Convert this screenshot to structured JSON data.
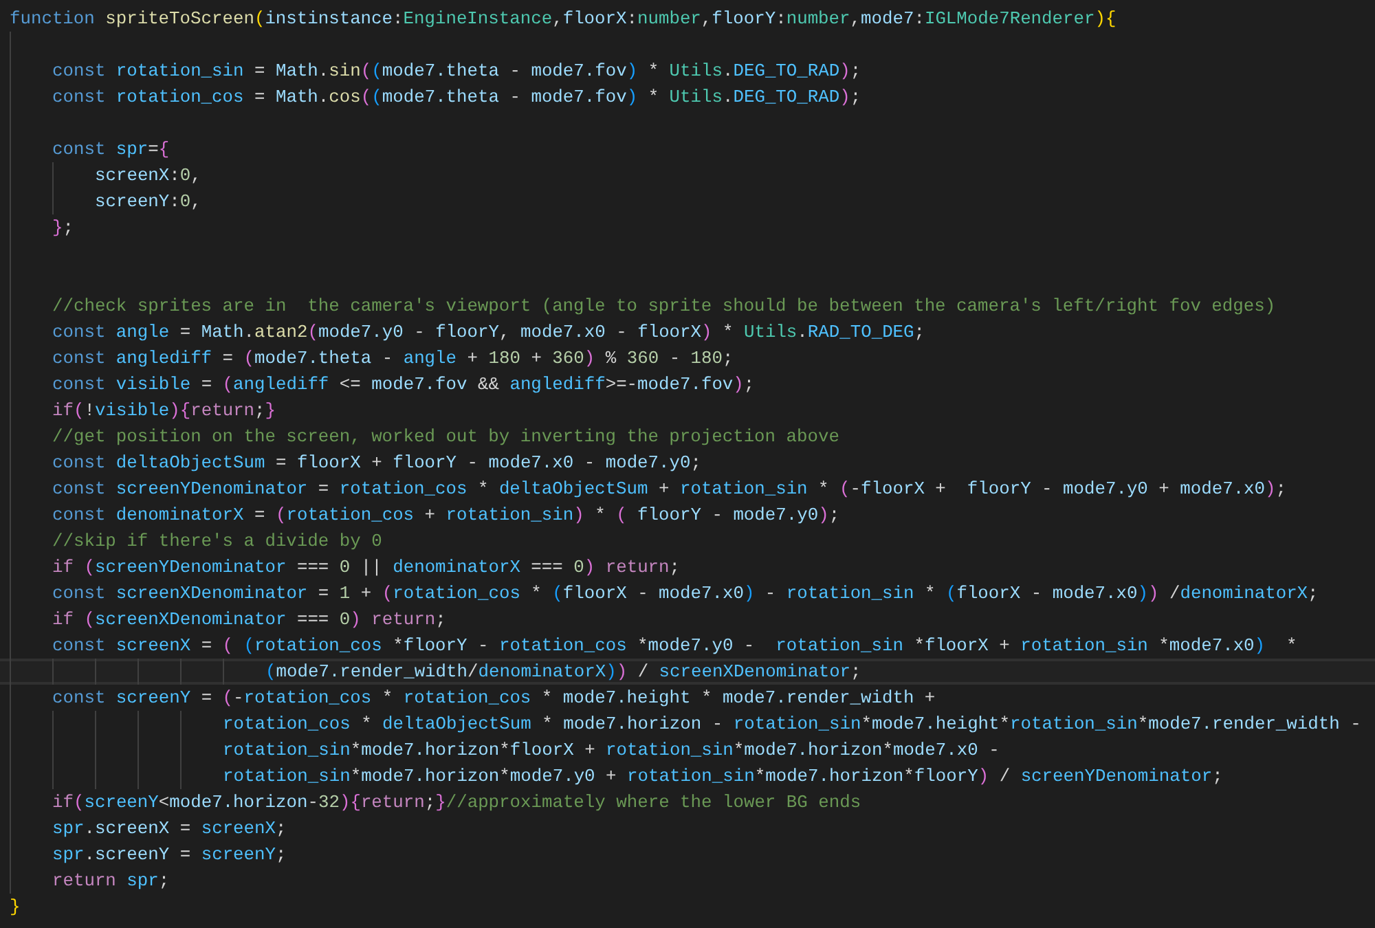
{
  "editor": {
    "lines": [
      {
        "current": false,
        "code": [
          {
            "kind": "kw",
            "text": "function "
          },
          {
            "kind": "fn",
            "text": "spriteToScreen"
          },
          {
            "kind": "b1",
            "text": "("
          },
          {
            "kind": "var",
            "text": "instinstance"
          },
          {
            "kind": "op",
            "text": ":"
          },
          {
            "kind": "type",
            "text": "EngineInstance"
          },
          {
            "kind": "op",
            "text": ","
          },
          {
            "kind": "var",
            "text": "floorX"
          },
          {
            "kind": "op",
            "text": ":"
          },
          {
            "kind": "type",
            "text": "number"
          },
          {
            "kind": "op",
            "text": ","
          },
          {
            "kind": "var",
            "text": "floorY"
          },
          {
            "kind": "op",
            "text": ":"
          },
          {
            "kind": "type",
            "text": "number"
          },
          {
            "kind": "op",
            "text": ","
          },
          {
            "kind": "var",
            "text": "mode7"
          },
          {
            "kind": "op",
            "text": ":"
          },
          {
            "kind": "type",
            "text": "IGLMode7Renderer"
          },
          {
            "kind": "b1",
            "text": "){"
          }
        ]
      },
      {
        "current": false
      },
      {
        "current": false,
        "code": [
          {
            "kind": "kw",
            "text": "    const "
          },
          {
            "kind": "cst",
            "text": "rotation_sin"
          },
          {
            "kind": "op",
            "text": " = "
          },
          {
            "kind": "var",
            "text": "Math"
          },
          {
            "kind": "op",
            "text": "."
          },
          {
            "kind": "fn",
            "text": "sin"
          },
          {
            "kind": "b2",
            "text": "("
          },
          {
            "kind": "b3",
            "text": "("
          },
          {
            "kind": "var",
            "text": "mode7.theta"
          },
          {
            "kind": "op",
            "text": " - "
          },
          {
            "kind": "var",
            "text": "mode7.fov"
          },
          {
            "kind": "b3",
            "text": ")"
          },
          {
            "kind": "op",
            "text": " * "
          },
          {
            "kind": "type",
            "text": "Utils"
          },
          {
            "kind": "op",
            "text": "."
          },
          {
            "kind": "cst",
            "text": "DEG_TO_RAD"
          },
          {
            "kind": "b2",
            "text": ")"
          },
          {
            "kind": "op",
            "text": ";"
          }
        ]
      },
      {
        "current": false,
        "code": [
          {
            "kind": "kw",
            "text": "    const "
          },
          {
            "kind": "cst",
            "text": "rotation_cos"
          },
          {
            "kind": "op",
            "text": " = "
          },
          {
            "kind": "var",
            "text": "Math"
          },
          {
            "kind": "op",
            "text": "."
          },
          {
            "kind": "fn",
            "text": "cos"
          },
          {
            "kind": "b2",
            "text": "("
          },
          {
            "kind": "b3",
            "text": "("
          },
          {
            "kind": "var",
            "text": "mode7.theta"
          },
          {
            "kind": "op",
            "text": " - "
          },
          {
            "kind": "var",
            "text": "mode7.fov"
          },
          {
            "kind": "b3",
            "text": ")"
          },
          {
            "kind": "op",
            "text": " * "
          },
          {
            "kind": "type",
            "text": "Utils"
          },
          {
            "kind": "op",
            "text": "."
          },
          {
            "kind": "cst",
            "text": "DEG_TO_RAD"
          },
          {
            "kind": "b2",
            "text": ")"
          },
          {
            "kind": "op",
            "text": ";"
          }
        ]
      },
      {
        "current": false
      },
      {
        "current": false,
        "code": [
          {
            "kind": "kw",
            "text": "    const "
          },
          {
            "kind": "cst",
            "text": "spr"
          },
          {
            "kind": "op",
            "text": "="
          },
          {
            "kind": "b2",
            "text": "{"
          }
        ]
      },
      {
        "current": false,
        "code": [
          {
            "kind": "var",
            "text": "        screenX"
          },
          {
            "kind": "op",
            "text": ":"
          },
          {
            "kind": "num",
            "text": "0"
          },
          {
            "kind": "op",
            "text": ","
          }
        ]
      },
      {
        "current": false,
        "code": [
          {
            "kind": "var",
            "text": "        screenY"
          },
          {
            "kind": "op",
            "text": ":"
          },
          {
            "kind": "num",
            "text": "0"
          },
          {
            "kind": "op",
            "text": ","
          }
        ]
      },
      {
        "current": false,
        "code": [
          {
            "kind": "b2",
            "text": "    }"
          },
          {
            "kind": "op",
            "text": ";"
          }
        ]
      },
      {
        "current": false
      },
      {
        "current": false
      },
      {
        "current": false,
        "code": [
          {
            "kind": "cmt",
            "text": "    //check sprites are in  the camera's viewport (angle to sprite should be between the camera's left/right fov edges)"
          }
        ]
      },
      {
        "current": false,
        "code": [
          {
            "kind": "kw",
            "text": "    const "
          },
          {
            "kind": "cst",
            "text": "angle"
          },
          {
            "kind": "op",
            "text": " = "
          },
          {
            "kind": "var",
            "text": "Math"
          },
          {
            "kind": "op",
            "text": "."
          },
          {
            "kind": "fn",
            "text": "atan2"
          },
          {
            "kind": "b2",
            "text": "("
          },
          {
            "kind": "var",
            "text": "mode7.y0"
          },
          {
            "kind": "op",
            "text": " - "
          },
          {
            "kind": "var",
            "text": "floorY"
          },
          {
            "kind": "op",
            "text": ", "
          },
          {
            "kind": "var",
            "text": "mode7.x0"
          },
          {
            "kind": "op",
            "text": " - "
          },
          {
            "kind": "var",
            "text": "floorX"
          },
          {
            "kind": "b2",
            "text": ")"
          },
          {
            "kind": "op",
            "text": " * "
          },
          {
            "kind": "type",
            "text": "Utils"
          },
          {
            "kind": "op",
            "text": "."
          },
          {
            "kind": "cst",
            "text": "RAD_TO_DEG"
          },
          {
            "kind": "op",
            "text": ";"
          }
        ]
      },
      {
        "current": false,
        "code": [
          {
            "kind": "kw",
            "text": "    const "
          },
          {
            "kind": "cst",
            "text": "anglediff"
          },
          {
            "kind": "op",
            "text": " = "
          },
          {
            "kind": "b2",
            "text": "("
          },
          {
            "kind": "var",
            "text": "mode7.theta"
          },
          {
            "kind": "op",
            "text": " - "
          },
          {
            "kind": "cst",
            "text": "angle"
          },
          {
            "kind": "op",
            "text": " + "
          },
          {
            "kind": "num",
            "text": "180"
          },
          {
            "kind": "op",
            "text": " + "
          },
          {
            "kind": "num",
            "text": "360"
          },
          {
            "kind": "b2",
            "text": ")"
          },
          {
            "kind": "op",
            "text": " % "
          },
          {
            "kind": "num",
            "text": "360"
          },
          {
            "kind": "op",
            "text": " - "
          },
          {
            "kind": "num",
            "text": "180"
          },
          {
            "kind": "op",
            "text": ";"
          }
        ]
      },
      {
        "current": false,
        "code": [
          {
            "kind": "kw",
            "text": "    const "
          },
          {
            "kind": "cst",
            "text": "visible"
          },
          {
            "kind": "op",
            "text": " = "
          },
          {
            "kind": "b2",
            "text": "("
          },
          {
            "kind": "cst",
            "text": "anglediff"
          },
          {
            "kind": "op",
            "text": " <= "
          },
          {
            "kind": "var",
            "text": "mode7.fov"
          },
          {
            "kind": "op",
            "text": " && "
          },
          {
            "kind": "cst",
            "text": "anglediff"
          },
          {
            "kind": "op",
            "text": ">=-"
          },
          {
            "kind": "var",
            "text": "mode7.fov"
          },
          {
            "kind": "b2",
            "text": ")"
          },
          {
            "kind": "op",
            "text": ";"
          }
        ]
      },
      {
        "current": false,
        "code": [
          {
            "kind": "ctl",
            "text": "    if"
          },
          {
            "kind": "b2",
            "text": "("
          },
          {
            "kind": "op",
            "text": "!"
          },
          {
            "kind": "cst",
            "text": "visible"
          },
          {
            "kind": "b2",
            "text": "){"
          },
          {
            "kind": "ctl",
            "text": "return"
          },
          {
            "kind": "op",
            "text": ";"
          },
          {
            "kind": "b2",
            "text": "}"
          }
        ]
      },
      {
        "current": false,
        "code": [
          {
            "kind": "cmt",
            "text": "    //get position on the screen, worked out by inverting the projection above"
          }
        ]
      },
      {
        "current": false,
        "code": [
          {
            "kind": "kw",
            "text": "    const "
          },
          {
            "kind": "cst",
            "text": "deltaObjectSum"
          },
          {
            "kind": "op",
            "text": " = "
          },
          {
            "kind": "var",
            "text": "floorX"
          },
          {
            "kind": "op",
            "text": " + "
          },
          {
            "kind": "var",
            "text": "floorY"
          },
          {
            "kind": "op",
            "text": " - "
          },
          {
            "kind": "var",
            "text": "mode7.x0"
          },
          {
            "kind": "op",
            "text": " - "
          },
          {
            "kind": "var",
            "text": "mode7.y0"
          },
          {
            "kind": "op",
            "text": ";"
          }
        ]
      },
      {
        "current": false,
        "code": [
          {
            "kind": "kw",
            "text": "    const "
          },
          {
            "kind": "cst",
            "text": "screenYDenominator"
          },
          {
            "kind": "op",
            "text": " = "
          },
          {
            "kind": "cst",
            "text": "rotation_cos"
          },
          {
            "kind": "op",
            "text": " * "
          },
          {
            "kind": "cst",
            "text": "deltaObjectSum"
          },
          {
            "kind": "op",
            "text": " + "
          },
          {
            "kind": "cst",
            "text": "rotation_sin"
          },
          {
            "kind": "op",
            "text": " * "
          },
          {
            "kind": "b2",
            "text": "("
          },
          {
            "kind": "op",
            "text": "-"
          },
          {
            "kind": "var",
            "text": "floorX"
          },
          {
            "kind": "op",
            "text": " +  "
          },
          {
            "kind": "var",
            "text": "floorY"
          },
          {
            "kind": "op",
            "text": " - "
          },
          {
            "kind": "var",
            "text": "mode7.y0"
          },
          {
            "kind": "op",
            "text": " + "
          },
          {
            "kind": "var",
            "text": "mode7.x0"
          },
          {
            "kind": "b2",
            "text": ")"
          },
          {
            "kind": "op",
            "text": ";"
          }
        ]
      },
      {
        "current": false,
        "code": [
          {
            "kind": "kw",
            "text": "    const "
          },
          {
            "kind": "cst",
            "text": "denominatorX"
          },
          {
            "kind": "op",
            "text": " = "
          },
          {
            "kind": "b2",
            "text": "("
          },
          {
            "kind": "cst",
            "text": "rotation_cos"
          },
          {
            "kind": "op",
            "text": " + "
          },
          {
            "kind": "cst",
            "text": "rotation_sin"
          },
          {
            "kind": "b2",
            "text": ")"
          },
          {
            "kind": "op",
            "text": " * "
          },
          {
            "kind": "b2",
            "text": "( "
          },
          {
            "kind": "var",
            "text": "floorY"
          },
          {
            "kind": "op",
            "text": " - "
          },
          {
            "kind": "var",
            "text": "mode7.y0"
          },
          {
            "kind": "b2",
            "text": ")"
          },
          {
            "kind": "op",
            "text": ";"
          }
        ]
      },
      {
        "current": false,
        "code": [
          {
            "kind": "cmt",
            "text": "    //skip if there's a divide by 0"
          }
        ]
      },
      {
        "current": false,
        "code": [
          {
            "kind": "ctl",
            "text": "    if "
          },
          {
            "kind": "b2",
            "text": "("
          },
          {
            "kind": "cst",
            "text": "screenYDenominator"
          },
          {
            "kind": "op",
            "text": " === "
          },
          {
            "kind": "num",
            "text": "0"
          },
          {
            "kind": "op",
            "text": " || "
          },
          {
            "kind": "cst",
            "text": "denominatorX"
          },
          {
            "kind": "op",
            "text": " === "
          },
          {
            "kind": "num",
            "text": "0"
          },
          {
            "kind": "b2",
            "text": ")"
          },
          {
            "kind": "ctl",
            "text": " return"
          },
          {
            "kind": "op",
            "text": ";"
          }
        ]
      },
      {
        "current": false,
        "code": [
          {
            "kind": "kw",
            "text": "    const "
          },
          {
            "kind": "cst",
            "text": "screenXDenominator"
          },
          {
            "kind": "op",
            "text": " = "
          },
          {
            "kind": "num",
            "text": "1"
          },
          {
            "kind": "op",
            "text": " + "
          },
          {
            "kind": "b2",
            "text": "("
          },
          {
            "kind": "cst",
            "text": "rotation_cos"
          },
          {
            "kind": "op",
            "text": " * "
          },
          {
            "kind": "b3",
            "text": "("
          },
          {
            "kind": "var",
            "text": "floorX"
          },
          {
            "kind": "op",
            "text": " - "
          },
          {
            "kind": "var",
            "text": "mode7.x0"
          },
          {
            "kind": "b3",
            "text": ")"
          },
          {
            "kind": "op",
            "text": " - "
          },
          {
            "kind": "cst",
            "text": "rotation_sin"
          },
          {
            "kind": "op",
            "text": " * "
          },
          {
            "kind": "b3",
            "text": "("
          },
          {
            "kind": "var",
            "text": "floorX"
          },
          {
            "kind": "op",
            "text": " - "
          },
          {
            "kind": "var",
            "text": "mode7.x0"
          },
          {
            "kind": "b3",
            "text": ")"
          },
          {
            "kind": "b2",
            "text": ")"
          },
          {
            "kind": "op",
            "text": " /"
          },
          {
            "kind": "cst",
            "text": "denominatorX"
          },
          {
            "kind": "op",
            "text": ";"
          }
        ]
      },
      {
        "current": false,
        "code": [
          {
            "kind": "ctl",
            "text": "    if "
          },
          {
            "kind": "b2",
            "text": "("
          },
          {
            "kind": "cst",
            "text": "screenXDenominator"
          },
          {
            "kind": "op",
            "text": " === "
          },
          {
            "kind": "num",
            "text": "0"
          },
          {
            "kind": "b2",
            "text": ")"
          },
          {
            "kind": "ctl",
            "text": " return"
          },
          {
            "kind": "op",
            "text": ";"
          }
        ]
      },
      {
        "current": false,
        "code": [
          {
            "kind": "kw",
            "text": "    const "
          },
          {
            "kind": "cst",
            "text": "screenX"
          },
          {
            "kind": "op",
            "text": " = "
          },
          {
            "kind": "b2",
            "text": "( "
          },
          {
            "kind": "b3",
            "text": "("
          },
          {
            "kind": "cst",
            "text": "rotation_cos"
          },
          {
            "kind": "op",
            "text": " *"
          },
          {
            "kind": "var",
            "text": "floorY"
          },
          {
            "kind": "op",
            "text": " - "
          },
          {
            "kind": "cst",
            "text": "rotation_cos"
          },
          {
            "kind": "op",
            "text": " *"
          },
          {
            "kind": "var",
            "text": "mode7.y0"
          },
          {
            "kind": "op",
            "text": " -  "
          },
          {
            "kind": "cst",
            "text": "rotation_sin"
          },
          {
            "kind": "op",
            "text": " *"
          },
          {
            "kind": "var",
            "text": "floorX"
          },
          {
            "kind": "op",
            "text": " + "
          },
          {
            "kind": "cst",
            "text": "rotation_sin"
          },
          {
            "kind": "op",
            "text": " *"
          },
          {
            "kind": "var",
            "text": "mode7.x0"
          },
          {
            "kind": "b3",
            "text": ")"
          },
          {
            "kind": "op",
            "text": "  *"
          }
        ]
      },
      {
        "current": true,
        "code": [
          {
            "kind": "b3",
            "text": "                        ("
          },
          {
            "kind": "var",
            "text": "mode7.render_width"
          },
          {
            "kind": "op",
            "text": "/"
          },
          {
            "kind": "cst",
            "text": "denominatorX"
          },
          {
            "kind": "b3",
            "text": ")"
          },
          {
            "kind": "b2",
            "text": ")"
          },
          {
            "kind": "op",
            "text": " / "
          },
          {
            "kind": "cst",
            "text": "screenXDenominator"
          },
          {
            "kind": "op",
            "text": ";"
          }
        ]
      },
      {
        "current": false,
        "code": [
          {
            "kind": "kw",
            "text": "    const "
          },
          {
            "kind": "cst",
            "text": "screenY"
          },
          {
            "kind": "op",
            "text": " = "
          },
          {
            "kind": "b2",
            "text": "("
          },
          {
            "kind": "op",
            "text": "-"
          },
          {
            "kind": "cst",
            "text": "rotation_cos"
          },
          {
            "kind": "op",
            "text": " * "
          },
          {
            "kind": "cst",
            "text": "rotation_cos"
          },
          {
            "kind": "op",
            "text": " * "
          },
          {
            "kind": "var",
            "text": "mode7.height"
          },
          {
            "kind": "op",
            "text": " * "
          },
          {
            "kind": "var",
            "text": "mode7.render_width"
          },
          {
            "kind": "op",
            "text": " +"
          }
        ]
      },
      {
        "current": false,
        "code": [
          {
            "kind": "cst",
            "text": "                    rotation_cos"
          },
          {
            "kind": "op",
            "text": " * "
          },
          {
            "kind": "cst",
            "text": "deltaObjectSum"
          },
          {
            "kind": "op",
            "text": " * "
          },
          {
            "kind": "var",
            "text": "mode7.horizon"
          },
          {
            "kind": "op",
            "text": " - "
          },
          {
            "kind": "cst",
            "text": "rotation_sin"
          },
          {
            "kind": "op",
            "text": "*"
          },
          {
            "kind": "var",
            "text": "mode7.height"
          },
          {
            "kind": "op",
            "text": "*"
          },
          {
            "kind": "cst",
            "text": "rotation_sin"
          },
          {
            "kind": "op",
            "text": "*"
          },
          {
            "kind": "var",
            "text": "mode7.render_width"
          },
          {
            "kind": "op",
            "text": " -"
          }
        ]
      },
      {
        "current": false,
        "code": [
          {
            "kind": "cst",
            "text": "                    rotation_sin"
          },
          {
            "kind": "op",
            "text": "*"
          },
          {
            "kind": "var",
            "text": "mode7.horizon"
          },
          {
            "kind": "op",
            "text": "*"
          },
          {
            "kind": "var",
            "text": "floorX"
          },
          {
            "kind": "op",
            "text": " + "
          },
          {
            "kind": "cst",
            "text": "rotation_sin"
          },
          {
            "kind": "op",
            "text": "*"
          },
          {
            "kind": "var",
            "text": "mode7.horizon"
          },
          {
            "kind": "op",
            "text": "*"
          },
          {
            "kind": "var",
            "text": "mode7.x0"
          },
          {
            "kind": "op",
            "text": " -"
          }
        ]
      },
      {
        "current": false,
        "code": [
          {
            "kind": "cst",
            "text": "                    rotation_sin"
          },
          {
            "kind": "op",
            "text": "*"
          },
          {
            "kind": "var",
            "text": "mode7.horizon"
          },
          {
            "kind": "op",
            "text": "*"
          },
          {
            "kind": "var",
            "text": "mode7.y0"
          },
          {
            "kind": "op",
            "text": " + "
          },
          {
            "kind": "cst",
            "text": "rotation_sin"
          },
          {
            "kind": "op",
            "text": "*"
          },
          {
            "kind": "var",
            "text": "mode7.horizon"
          },
          {
            "kind": "op",
            "text": "*"
          },
          {
            "kind": "var",
            "text": "floorY"
          },
          {
            "kind": "b2",
            "text": ")"
          },
          {
            "kind": "op",
            "text": " / "
          },
          {
            "kind": "cst",
            "text": "screenYDenominator"
          },
          {
            "kind": "op",
            "text": ";"
          }
        ]
      },
      {
        "current": false,
        "code": [
          {
            "kind": "ctl",
            "text": "    if"
          },
          {
            "kind": "b2",
            "text": "("
          },
          {
            "kind": "cst",
            "text": "screenY"
          },
          {
            "kind": "op",
            "text": "<"
          },
          {
            "kind": "var",
            "text": "mode7.horizon"
          },
          {
            "kind": "op",
            "text": "-"
          },
          {
            "kind": "num",
            "text": "32"
          },
          {
            "kind": "b2",
            "text": "){"
          },
          {
            "kind": "ctl",
            "text": "return"
          },
          {
            "kind": "op",
            "text": ";"
          },
          {
            "kind": "b2",
            "text": "}"
          },
          {
            "kind": "cmt",
            "text": "//approximately where the lower BG ends"
          }
        ]
      },
      {
        "current": false,
        "code": [
          {
            "kind": "cst",
            "text": "    spr"
          },
          {
            "kind": "op",
            "text": "."
          },
          {
            "kind": "var",
            "text": "screenX"
          },
          {
            "kind": "op",
            "text": " = "
          },
          {
            "kind": "cst",
            "text": "screenX"
          },
          {
            "kind": "op",
            "text": ";"
          }
        ]
      },
      {
        "current": false,
        "code": [
          {
            "kind": "cst",
            "text": "    spr"
          },
          {
            "kind": "op",
            "text": "."
          },
          {
            "kind": "var",
            "text": "screenY"
          },
          {
            "kind": "op",
            "text": " = "
          },
          {
            "kind": "cst",
            "text": "screenY"
          },
          {
            "kind": "op",
            "text": ";"
          }
        ]
      },
      {
        "current": false,
        "code": [
          {
            "kind": "ctl",
            "text": "    return "
          },
          {
            "kind": "cst",
            "text": "spr"
          },
          {
            "kind": "op",
            "text": ";"
          }
        ]
      },
      {
        "current": false,
        "code": [
          {
            "kind": "b1",
            "text": "}"
          }
        ]
      }
    ]
  }
}
